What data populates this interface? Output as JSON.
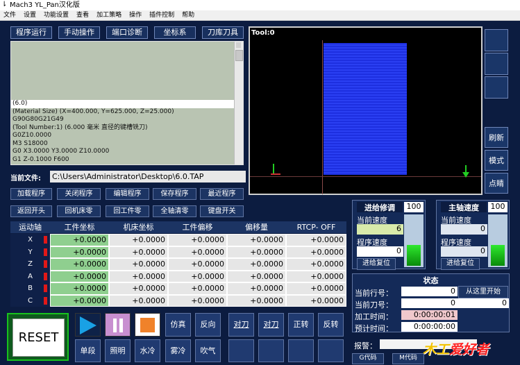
{
  "window": {
    "title": "Mach3 YL_Pan汉化版"
  },
  "menu": [
    "文件",
    "设置",
    "功能设置",
    "查看",
    "加工策略",
    "操作",
    "插件控制",
    "帮助"
  ],
  "tabs": [
    "程序运行",
    "手动操作",
    "端口诊断",
    "坐标系",
    "刀库刀具"
  ],
  "gcode_lines": [
    "(6.0)",
    "(Material Size) (X=400.000, Y=625.000, Z=25.000)",
    "G90G80G21G49",
    "(Tool Number:1) (6.000 毫米 直径的键槽铣刀)",
    "G0Z10.0000",
    "M3 S18000",
    "G0 X3.0000 Y3.0000 Z10.0000",
    "G1   Z-0.1000 F600"
  ],
  "toolview": {
    "label": "Tool:0"
  },
  "side_buttons": [
    "刷新",
    "模式",
    "点睛"
  ],
  "file": {
    "label": "当前文件:",
    "path": "C:\\Users\\Administrator\\Desktop\\6.0.TAP"
  },
  "prog_buttons_row1": [
    "加载程序",
    "关闭程序",
    "编辑程序",
    "保存程序",
    "最近程序"
  ],
  "prog_buttons_row2": [
    "返回开头",
    "回机床零",
    "回工件零",
    "全轴清零",
    "键盘开关"
  ],
  "axes_table": {
    "headers": [
      "运动轴",
      "工件坐标",
      "机床坐标",
      "工件偏移",
      "偏移量",
      "RTCP- OFF"
    ],
    "rows": [
      {
        "axis": "X",
        "work": "+0.0000",
        "machine": "+0.0000",
        "offset": "+0.0000",
        "amount": "+0.0000",
        "rtcp": "+0.0000"
      },
      {
        "axis": "Y",
        "work": "+0.0000",
        "machine": "+0.0000",
        "offset": "+0.0000",
        "amount": "+0.0000",
        "rtcp": "+0.0000"
      },
      {
        "axis": "Z",
        "work": "+0.0000",
        "machine": "+0.0000",
        "offset": "+0.0000",
        "amount": "+0.0000",
        "rtcp": "+0.0000"
      },
      {
        "axis": "A",
        "work": "+0.0000",
        "machine": "+0.0000",
        "offset": "+0.0000",
        "amount": "+0.0000",
        "rtcp": "+0.0000"
      },
      {
        "axis": "B",
        "work": "+0.0000",
        "machine": "+0.0000",
        "offset": "+0.0000",
        "amount": "+0.0000",
        "rtcp": "+0.0000"
      },
      {
        "axis": "C",
        "work": "+0.0000",
        "machine": "+0.0000",
        "offset": "+0.0000",
        "amount": "+0.0000",
        "rtcp": "+0.0000"
      }
    ]
  },
  "feed": {
    "title": "进给修调",
    "percent": "100",
    "cur_label": "当前速度",
    "cur_value": "6",
    "prog_label": "程序速度",
    "prog_value": "0",
    "reset": "进给复位"
  },
  "spindle": {
    "title": "主轴速度",
    "percent": "100",
    "cur_label": "当前速度",
    "cur_value": "0",
    "prog_label": "程序速度",
    "prog_value": "0",
    "reset": "进给复位"
  },
  "status": {
    "title": "状态",
    "line_label": "当前行号：",
    "line_value": "0",
    "tool_label": "当前刀号：",
    "tool_value": "0",
    "from_here": "从这里开始",
    "from_value": "0",
    "time_label": "加工时间：",
    "time_value": "0:00:00:01",
    "est_label": "预计时间：",
    "est_value": "0:00:00:00"
  },
  "alarm": {
    "label": "报警：",
    "gcode": "G代码",
    "mcode": "M代码"
  },
  "controls": {
    "reset": "RESET",
    "row1": [
      "仿真",
      "反向",
      "对刀",
      "对刀",
      "正转",
      "反转"
    ],
    "row2": [
      "单段",
      "照明",
      "水冷",
      "雾冷",
      "吹气"
    ]
  },
  "watermark": "爱好者",
  "watermark_left": "木工"
}
